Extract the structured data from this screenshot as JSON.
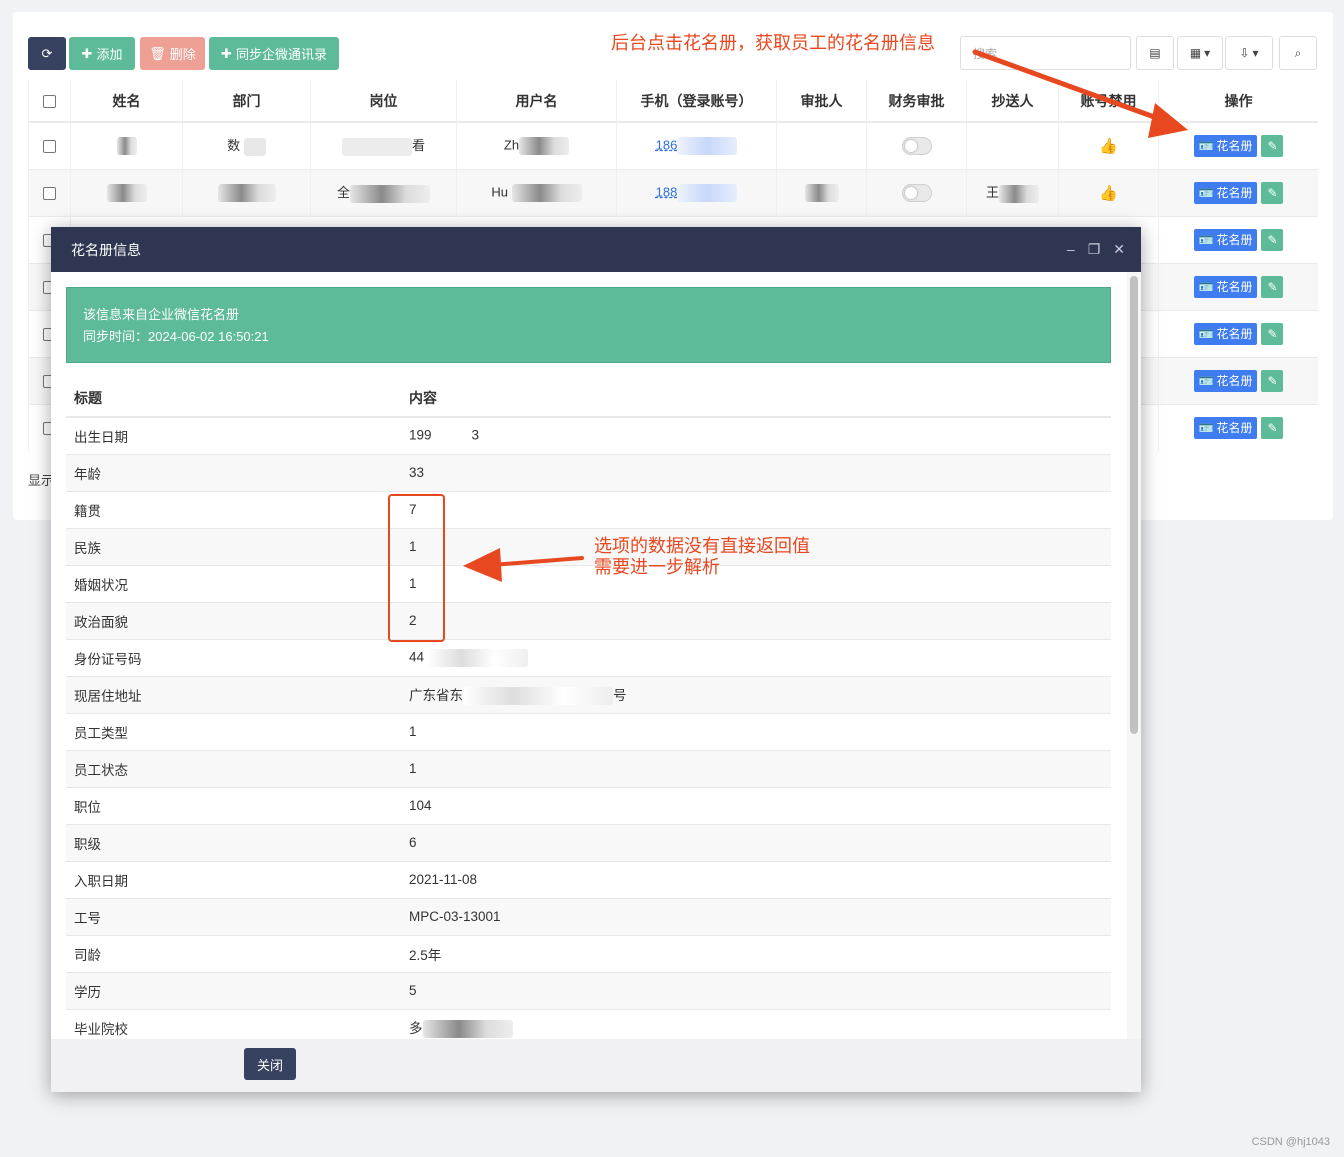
{
  "toolbar": {
    "add_label": "添加",
    "delete_label": "删除",
    "sync_label": "同步企微通讯录",
    "search_placeholder": "搜索"
  },
  "table": {
    "headers": [
      "姓名",
      "部门",
      "岗位",
      "用户名",
      "手机（登录账号）",
      "审批人",
      "财务审批",
      "抄送人",
      "账号禁用",
      "操作"
    ],
    "rows": [
      {
        "dept": "数",
        "post_suffix": "看",
        "username": "Zh",
        "phone": "186"
      },
      {
        "dept": "",
        "post": "全",
        "username": "Hu",
        "phone": "188",
        "cc": "王"
      }
    ],
    "roster_button": "花名册",
    "footer_text": "显示"
  },
  "annotations": {
    "top": "后台点击花名册，获取员工的花名册信息",
    "mid_line1": "选项的数据没有直接返回值",
    "mid_line2": "需要进一步解析"
  },
  "modal": {
    "title": "花名册信息",
    "info_line1": "该信息来自企业微信花名册",
    "info_line2": "同步时间：2024-06-02 16:50:21",
    "col_title": "标题",
    "col_content": "内容",
    "rows": [
      {
        "label": "出生日期",
        "value": "199"
      },
      {
        "label": "年龄",
        "value": "33"
      },
      {
        "label": "籍贯",
        "value": "7"
      },
      {
        "label": "民族",
        "value": "1"
      },
      {
        "label": "婚姻状况",
        "value": "1"
      },
      {
        "label": "政治面貌",
        "value": "2"
      },
      {
        "label": "身份证号码",
        "value": "44"
      },
      {
        "label": "现居住地址",
        "value": "广东省东"
      },
      {
        "label": "员工类型",
        "value": "1"
      },
      {
        "label": "员工状态",
        "value": "1"
      },
      {
        "label": "职位",
        "value": "104"
      },
      {
        "label": "职级",
        "value": "6"
      },
      {
        "label": "入职日期",
        "value": "2021-11-08"
      },
      {
        "label": "工号",
        "value": "MPC-03-13001"
      },
      {
        "label": "司龄",
        "value": "2.5年"
      },
      {
        "label": "学历",
        "value": "5"
      },
      {
        "label": "毕业院校",
        "value": "多"
      }
    ],
    "close_label": "关闭"
  },
  "watermark": "CSDN @hj1043"
}
